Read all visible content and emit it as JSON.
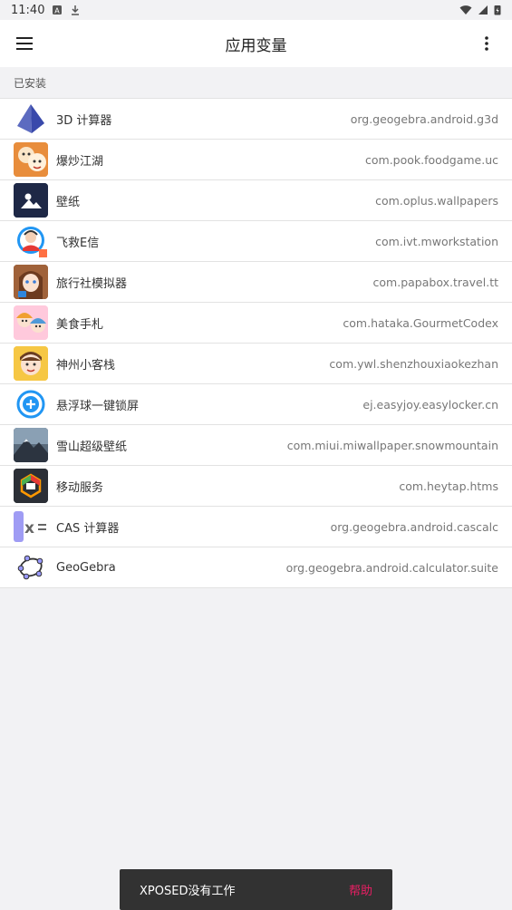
{
  "status": {
    "time": "11:40"
  },
  "header": {
    "title": "应用变量"
  },
  "section": {
    "label": "已安装"
  },
  "apps": [
    {
      "name": "3D 计算器",
      "package": "org.geogebra.android.g3d",
      "icon": "pyramid-icon"
    },
    {
      "name": "爆炒江湖",
      "package": "com.pook.foodgame.uc",
      "icon": "cartoon-chef-icon"
    },
    {
      "name": "壁纸",
      "package": "com.oplus.wallpapers",
      "icon": "mountain-picture-icon"
    },
    {
      "name": "飞救E信",
      "package": "com.ivt.mworkstation",
      "icon": "rescue-avatar-icon"
    },
    {
      "name": "旅行社模拟器",
      "package": "com.papabox.travel.tt",
      "icon": "anime-girl-icon"
    },
    {
      "name": "美食手札",
      "package": "com.hataka.GourmetCodex",
      "icon": "anime-characters-icon"
    },
    {
      "name": "神州小客栈",
      "package": "com.ywl.shenzhouxiaokezhan",
      "icon": "cartoon-innkeeper-icon"
    },
    {
      "name": "悬浮球一键锁屏",
      "package": "ej.easyjoy.easylocker.cn",
      "icon": "floating-ball-plus-icon"
    },
    {
      "name": "雪山超级壁纸",
      "package": "com.miui.miwallpaper.snowmountain",
      "icon": "snow-mountain-icon"
    },
    {
      "name": "移动服务",
      "package": "com.heytap.htms",
      "icon": "mobile-service-hexagon-icon"
    },
    {
      "name": "CAS 计算器",
      "package": "org.geogebra.android.cascalc",
      "icon": "cas-x-equals-icon"
    },
    {
      "name": "GeoGebra",
      "package": "org.geogebra.android.calculator.suite",
      "icon": "geogebra-ellipse-icon"
    }
  ],
  "snackbar": {
    "message": "XPOSED没有工作",
    "action": "帮助"
  },
  "colors": {
    "background": "#f2f2f4",
    "snackbar": "#323232",
    "snackbar_action": "#e91e63"
  }
}
